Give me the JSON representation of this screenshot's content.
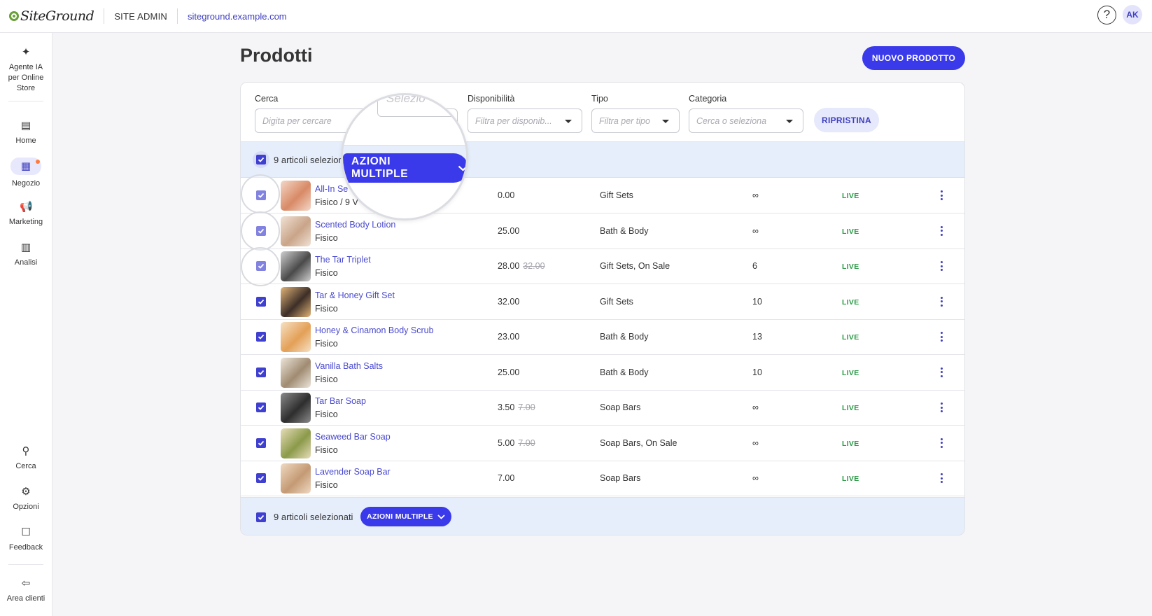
{
  "header": {
    "logo_text": "SiteGround",
    "site_admin": "SITE ADMIN",
    "domain": "siteground.example.com",
    "help_glyph": "?",
    "avatar_initials": "AK"
  },
  "sidebar": {
    "items": [
      {
        "label_lines": [
          "Agente IA",
          "per Online",
          "Store"
        ],
        "icon": "sparkle-icon"
      },
      {
        "label": "Home",
        "icon": "home-icon"
      },
      {
        "label": "Negozio",
        "icon": "store-icon",
        "active": true,
        "notification": true
      },
      {
        "label": "Marketing",
        "icon": "megaphone-icon"
      },
      {
        "label": "Analisi",
        "icon": "chart-icon"
      },
      {
        "label": "Cerca",
        "icon": "search-icon"
      },
      {
        "label": "Opzioni",
        "icon": "gear-icon"
      },
      {
        "label": "Feedback",
        "icon": "feedback-icon"
      },
      {
        "label": "Area clienti",
        "icon": "exit-icon"
      }
    ]
  },
  "page": {
    "title": "Prodotti",
    "new_button": "NUOVO PRODOTTO"
  },
  "filters": {
    "search": {
      "label": "Cerca",
      "placeholder": "Digita per cercare"
    },
    "select": {
      "placeholder": "Selezio"
    },
    "availability": {
      "label": "Disponibilità",
      "placeholder": "Filtra per disponib..."
    },
    "type": {
      "label": "Tipo",
      "placeholder": "Filtra per tipo"
    },
    "category": {
      "label": "Categoria",
      "placeholder": "Cerca o seleziona"
    },
    "reset_button": "RIPRISTINA"
  },
  "bulk": {
    "selected_text_top": "9 articoli selezion",
    "selected_text_bottom": "9 articoli selezionati",
    "actions_button": "AZIONI MULTIPLE"
  },
  "products": [
    {
      "name": "All-In Se",
      "type": "Fisico / 9 V",
      "price": "0.00",
      "old_price": "",
      "category": "Gift Sets",
      "stock": "∞",
      "status": "LIVE",
      "colors": [
        "#d88a66",
        "#f3d7c7"
      ]
    },
    {
      "name": "Scented Body Lotion",
      "type": "Fisico",
      "price": "25.00",
      "old_price": "",
      "category": "Bath & Body",
      "stock": "∞",
      "status": "LIVE",
      "colors": [
        "#c9a489",
        "#f0e2d4"
      ]
    },
    {
      "name": "The Tar Triplet",
      "type": "Fisico",
      "price": "28.00",
      "old_price": "32.00",
      "category": "Gift Sets, On Sale",
      "stock": "6",
      "status": "LIVE",
      "colors": [
        "#4a4a4a",
        "#cfcfcf"
      ]
    },
    {
      "name": "Tar & Honey Gift Set",
      "type": "Fisico",
      "price": "32.00",
      "old_price": "",
      "category": "Gift Sets",
      "stock": "10",
      "status": "LIVE",
      "colors": [
        "#3c2e27",
        "#e2b477"
      ]
    },
    {
      "name": "Honey & Cinamon Body Scrub",
      "type": "Fisico",
      "price": "23.00",
      "old_price": "",
      "category": "Bath & Body",
      "stock": "13",
      "status": "LIVE",
      "colors": [
        "#e3a057",
        "#f6e1c4"
      ]
    },
    {
      "name": "Vanilla Bath Salts",
      "type": "Fisico",
      "price": "25.00",
      "old_price": "",
      "category": "Bath & Body",
      "stock": "10",
      "status": "LIVE",
      "colors": [
        "#a08b72",
        "#ece5da"
      ]
    },
    {
      "name": "Tar Bar Soap",
      "type": "Fisico",
      "price": "3.50",
      "old_price": "7.00",
      "category": "Soap Bars",
      "stock": "∞",
      "status": "LIVE",
      "colors": [
        "#2e2e2e",
        "#8a8a8a"
      ]
    },
    {
      "name": "Seaweed Bar Soap",
      "type": "Fisico",
      "price": "5.00",
      "old_price": "7.00",
      "category": "Soap Bars, On Sale",
      "stock": "∞",
      "status": "LIVE",
      "colors": [
        "#8b9a4a",
        "#e7dcb8"
      ]
    },
    {
      "name": "Lavender Soap Bar",
      "type": "Fisico",
      "price": "7.00",
      "old_price": "",
      "category": "Soap Bars",
      "stock": "∞",
      "status": "LIVE",
      "colors": [
        "#c49a74",
        "#efd9c2"
      ]
    }
  ],
  "colors": {
    "accent": "#3a3aeb",
    "link": "#4a4ad0",
    "live": "#2a9a45",
    "bulk_bg": "#e6eefc"
  }
}
